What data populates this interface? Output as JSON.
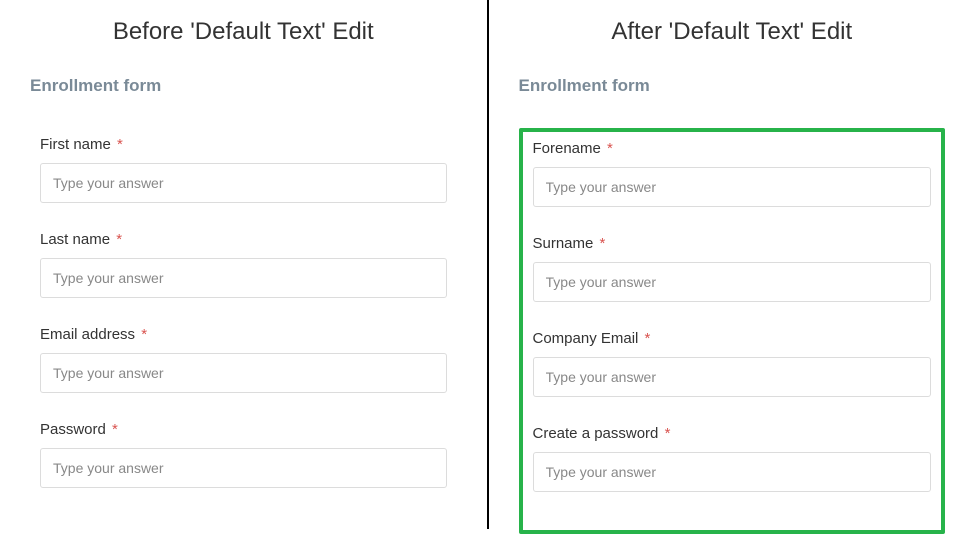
{
  "before": {
    "heading": "Before 'Default Text' Edit",
    "form_title": "Enrollment form",
    "common_placeholder": "Type your answer",
    "required_mark": "*",
    "fields": [
      {
        "label": "First name"
      },
      {
        "label": "Last name"
      },
      {
        "label": "Email address"
      },
      {
        "label": "Password"
      }
    ]
  },
  "after": {
    "heading": "After 'Default Text' Edit",
    "form_title": "Enrollment form",
    "common_placeholder": "Type your answer",
    "required_mark": "*",
    "fields": [
      {
        "label": "Forename"
      },
      {
        "label": "Surname"
      },
      {
        "label": "Company Email"
      },
      {
        "label": "Create a password"
      }
    ]
  }
}
